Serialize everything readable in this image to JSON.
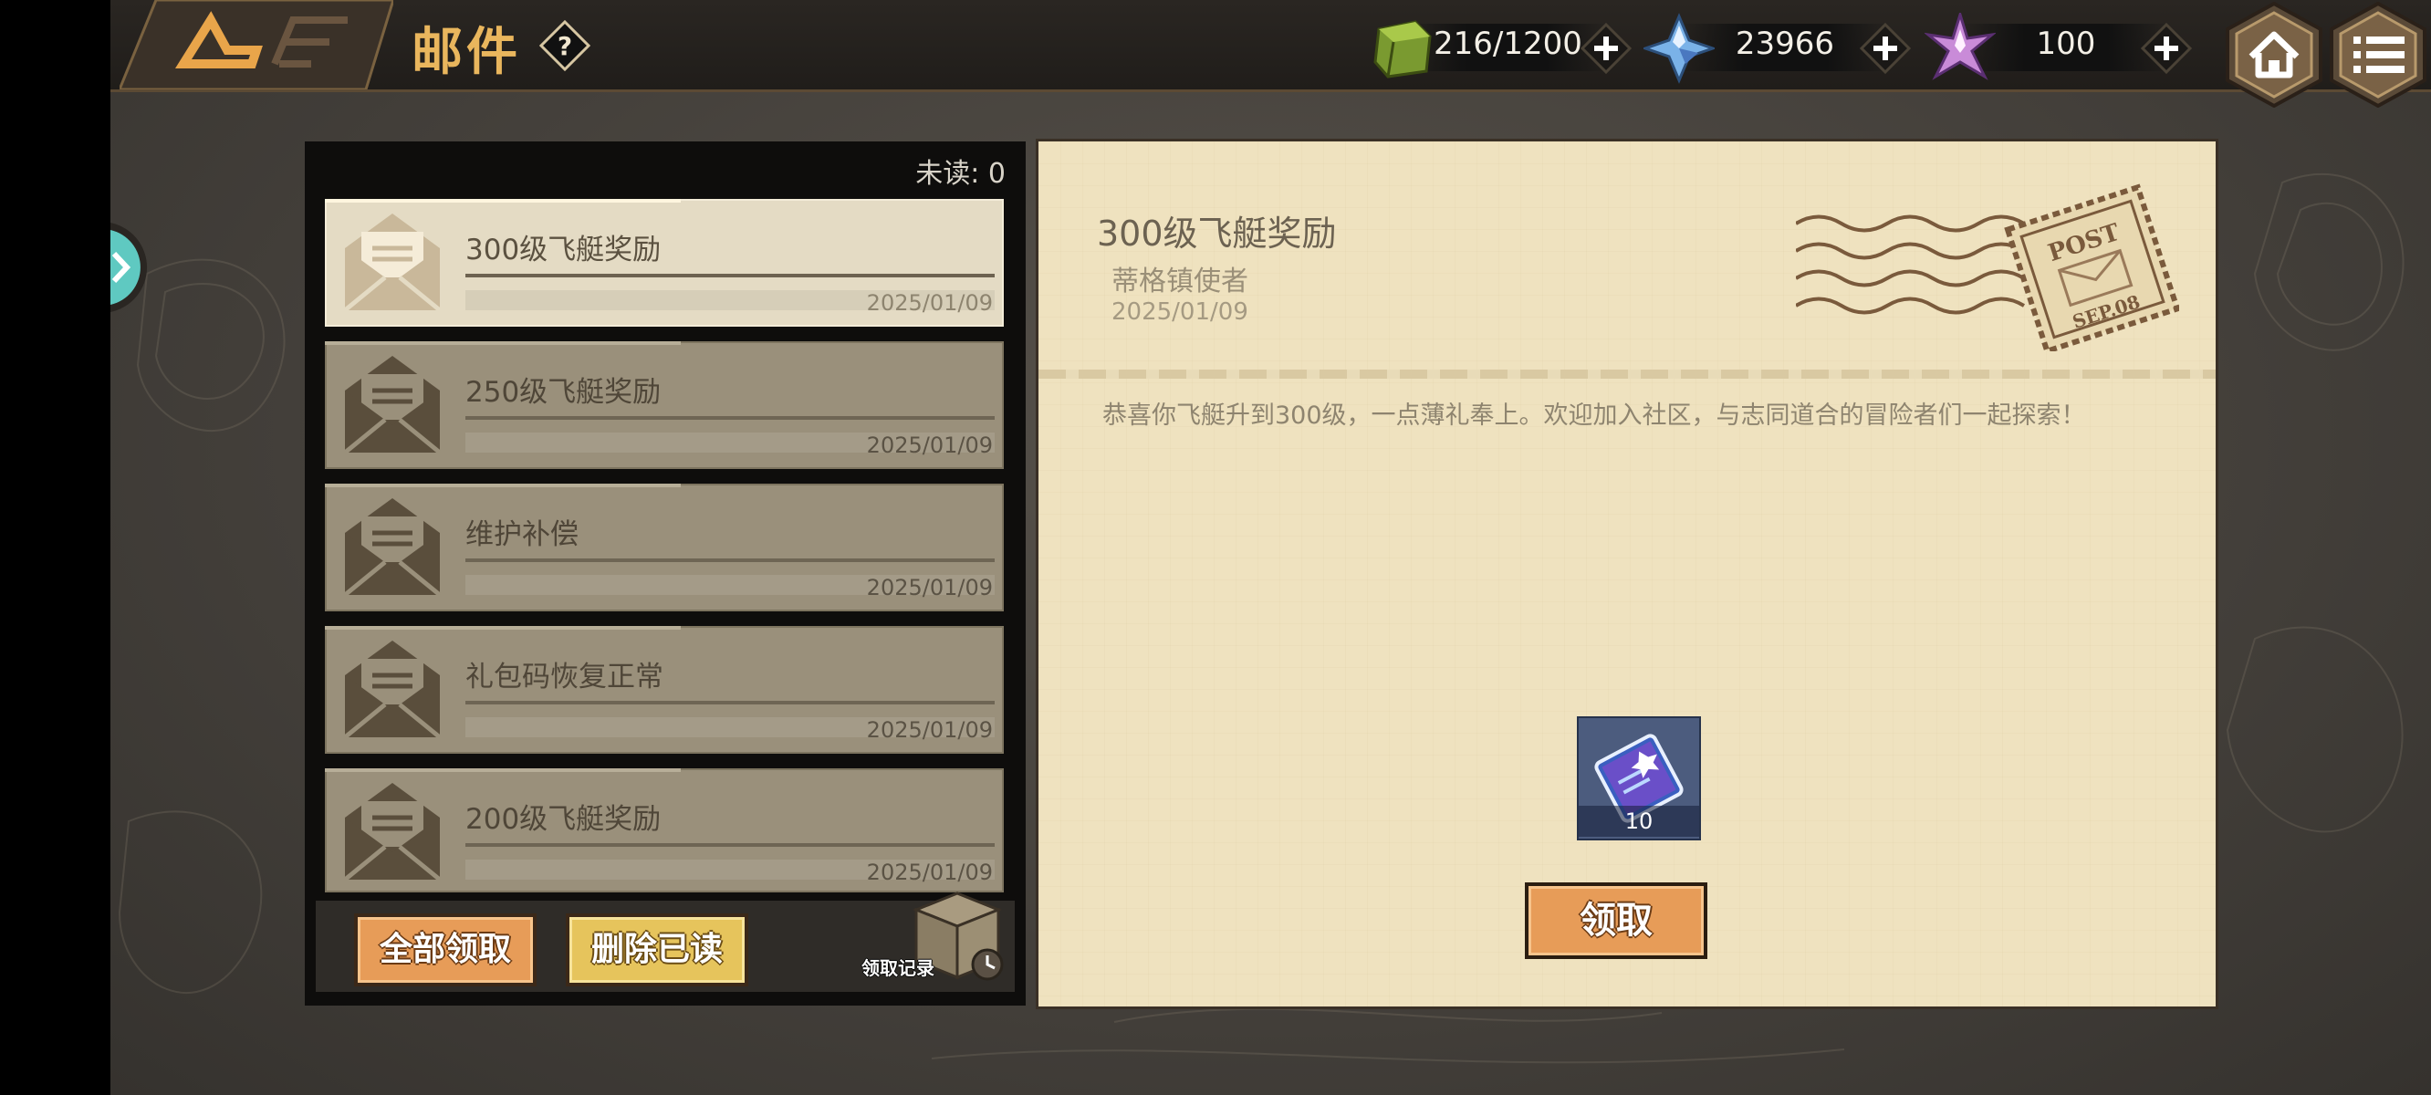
{
  "header": {
    "title": "邮件",
    "help_icon": "question-icon",
    "resources": [
      {
        "icon": "green-cube-icon",
        "value": "216/1200"
      },
      {
        "icon": "crystal-icon",
        "value": "23966"
      },
      {
        "icon": "star-crystal-icon",
        "value": "100"
      }
    ],
    "home_icon": "home-icon",
    "menu_icon": "menu-icon"
  },
  "mail_list": {
    "unread_label": "未读: 0",
    "items": [
      {
        "title": "300级飞艇奖励",
        "date": "2025/01/09",
        "selected": true
      },
      {
        "title": "250级飞艇奖励",
        "date": "2025/01/09",
        "selected": false
      },
      {
        "title": "维护补偿",
        "date": "2025/01/09",
        "selected": false
      },
      {
        "title": "礼包码恢复正常",
        "date": "2025/01/09",
        "selected": false
      },
      {
        "title": "200级飞艇奖励",
        "date": "2025/01/09",
        "selected": false
      }
    ],
    "claim_all_label": "全部领取",
    "delete_read_label": "删除已读",
    "record_label": "领取记录"
  },
  "letter": {
    "title": "300级飞艇奖励",
    "sender": "蒂格镇使者",
    "date": "2025/01/09",
    "body": "恭喜你飞艇升到300级，一点薄礼奉上。欢迎加入社区，与志同道合的冒险者们一起探索！",
    "stamp_text": "POST",
    "stamp_date": "SEP.08",
    "reward_count": "10",
    "claim_label": "领取"
  },
  "colors": {
    "accent_orange": "#e79c58",
    "title_gold": "#e9b65d",
    "paper": "#efe2bf"
  }
}
